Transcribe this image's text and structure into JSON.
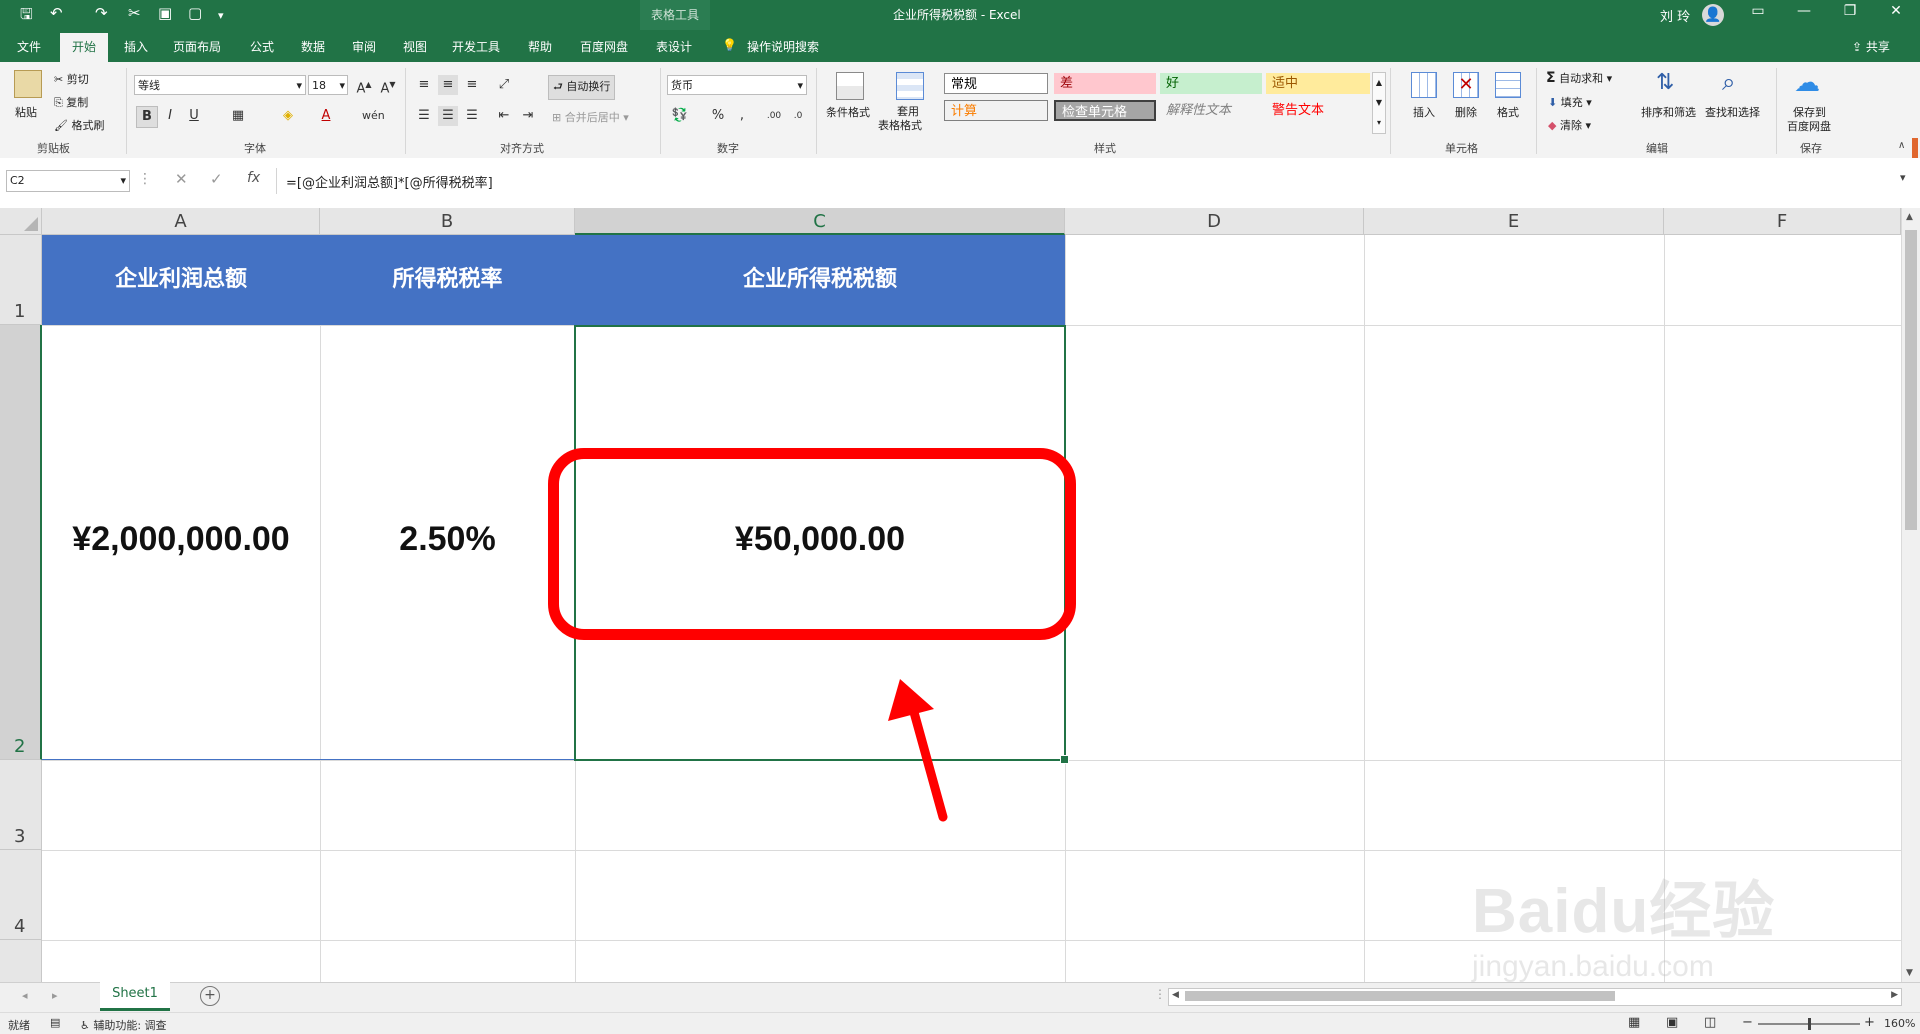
{
  "titlebar": {
    "doc_title": "企业所得税税额  -  Excel",
    "context_tab": "表格工具",
    "user": "刘 玲"
  },
  "tabs": [
    "文件",
    "开始",
    "插入",
    "页面布局",
    "公式",
    "数据",
    "审阅",
    "视图",
    "开发工具",
    "帮助",
    "百度网盘",
    "表设计"
  ],
  "tell_me": "操作说明搜索",
  "share": "共享",
  "ribbon": {
    "clipboard": {
      "paste": "粘贴",
      "cut": "剪切",
      "copy": "复制",
      "format_painter": "格式刷",
      "label": "剪贴板"
    },
    "font": {
      "name": "等线",
      "size": "18",
      "label": "字体"
    },
    "alignment": {
      "wrap": "自动换行",
      "merge": "合并后居中",
      "label": "对齐方式"
    },
    "number": {
      "format": "货币",
      "label": "数字"
    },
    "styles": {
      "conditional": "条件格式",
      "table_format_1": "套用",
      "table_format_2": "表格格式",
      "cells": [
        {
          "text": "常规",
          "bg": "#ffffff",
          "color": "#000000"
        },
        {
          "text": "差",
          "bg": "#ffc7ce",
          "color": "#9c0006"
        },
        {
          "text": "好",
          "bg": "#c6efce",
          "color": "#006100"
        },
        {
          "text": "适中",
          "bg": "#ffeb9c",
          "color": "#9c5700"
        },
        {
          "text": "计算",
          "bg": "#f2f2f2",
          "color": "#fa7d00"
        },
        {
          "text": "检查单元格",
          "bg": "#a5a5a5",
          "color": "#ffffff"
        },
        {
          "text": "解释性文本",
          "bg": "#f3f3f3",
          "color": "#7f7f7f"
        },
        {
          "text": "警告文本",
          "bg": "#f3f3f3",
          "color": "#ff0000"
        }
      ],
      "label": "样式"
    },
    "cells_group": {
      "insert": "插入",
      "delete": "删除",
      "format": "格式",
      "label": "单元格"
    },
    "editing": {
      "autosum": "自动求和",
      "fill": "填充",
      "clear": "清除",
      "sort": "排序和筛选",
      "find": "查找和选择",
      "label": "编辑"
    },
    "save": {
      "line1": "保存到",
      "line2": "百度网盘",
      "label": "保存"
    }
  },
  "formula_bar": {
    "name_box": "C2",
    "formula": "=[@企业利润总额]*[@所得税税率]"
  },
  "columns": [
    "A",
    "B",
    "C",
    "D",
    "E",
    "F"
  ],
  "rows": [
    "1",
    "2",
    "3",
    "4"
  ],
  "table": {
    "headers": [
      "企业利润总额",
      "所得税税率",
      "企业所得税税额"
    ],
    "values": [
      "¥2,000,000.00",
      "2.50%",
      "¥50,000.00"
    ]
  },
  "sheet_tab": "Sheet1",
  "status": {
    "ready": "就绪",
    "accessibility": "辅助功能: 调查",
    "zoom": "160%"
  },
  "watermark": {
    "line1": "Baidu经验",
    "line2": "jingyan.baidu.com"
  },
  "colors": {
    "excel_green": "#217346",
    "header_blue": "#4472c4",
    "highlight_red": "#ff0000"
  }
}
